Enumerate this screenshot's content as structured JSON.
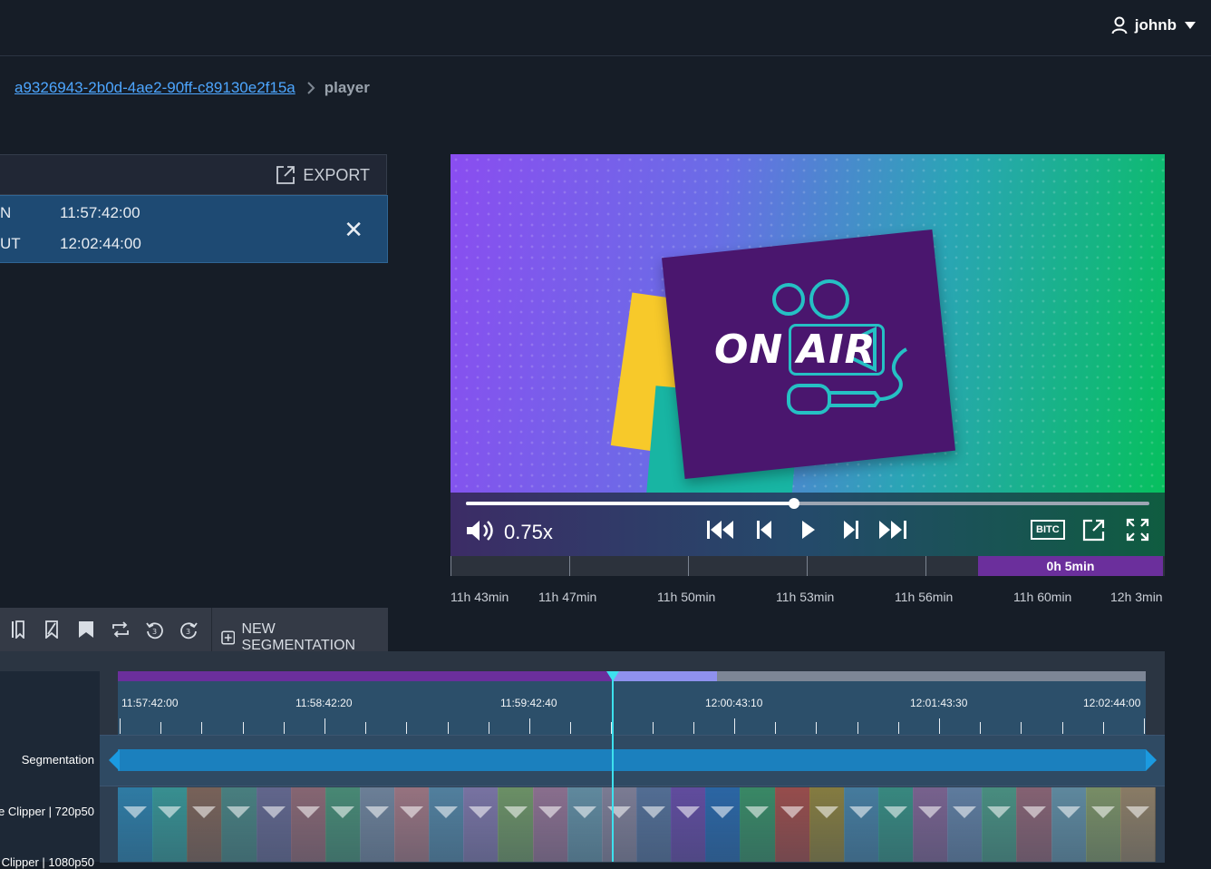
{
  "header": {
    "username": "johnb",
    "user_icon": "user-icon",
    "menu_icon": "caret-down-icon"
  },
  "breadcrumb": {
    "asset_id": "a9326943-2b0d-4ae2-90ff-c89130e2f15a",
    "current": "player"
  },
  "in_out_panel": {
    "export_label": "EXPORT",
    "in_label": "N",
    "in_value": "11:57:42:00",
    "out_label": "UT",
    "out_value": "12:02:44:00",
    "close_glyph": "✕"
  },
  "video": {
    "onair_text_1": "ON",
    "onair_text_2": "AIR",
    "progress": 0.48,
    "speed": "0.75x",
    "bitc_label": "BITC",
    "colors": {
      "gradient_start": "#8a4df0",
      "gradient_end": "#05c15a",
      "card": "#4a166e",
      "accent": "#25c0c4"
    }
  },
  "overview": {
    "selection_label": "0h 5min",
    "labels": [
      "11h 43min",
      "11h 47min",
      "11h 50min",
      "11h 53min",
      "11h 56min",
      "11h 60min",
      "12h 3min"
    ]
  },
  "toolbar": {
    "new_segmentation_label": "NEW SEGMENTATION"
  },
  "timeline": {
    "ruler_labels": [
      "11:57:42:00",
      "11:58:42:20",
      "11:59:42:40",
      "12:00:43:10",
      "12:01:43:30",
      "12:02:44:00"
    ],
    "rows": [
      "Segmentation",
      "e Clipper | 720p50",
      "Clipper | 1080p50"
    ]
  }
}
